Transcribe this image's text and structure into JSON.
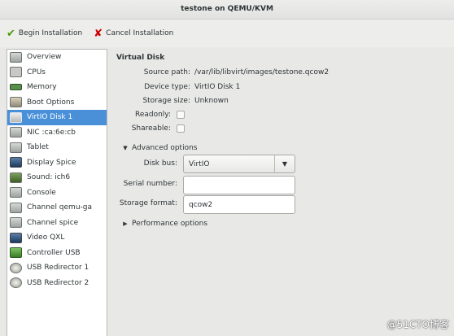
{
  "window": {
    "title": "testone on QEMU/KVM"
  },
  "toolbar": {
    "begin_label": "Begin Installation",
    "cancel_label": "Cancel Installation",
    "begin_icon": "check-icon",
    "cancel_icon": "cancel-x-icon"
  },
  "sidebar": {
    "selected_index": 5,
    "items": [
      {
        "label": "Overview",
        "icon": "overview-icon"
      },
      {
        "label": "CPUs",
        "icon": "cpu-icon"
      },
      {
        "label": "Memory",
        "icon": "memory-icon"
      },
      {
        "label": "Boot Options",
        "icon": "boot-options-icon"
      },
      {
        "label": "VirtIO Disk 1",
        "icon": "disk-icon"
      },
      {
        "label": "NIC :ca:6e:cb",
        "icon": "nic-icon"
      },
      {
        "label": "Tablet",
        "icon": "tablet-icon"
      },
      {
        "label": "Display Spice",
        "icon": "display-icon"
      },
      {
        "label": "Sound: ich6",
        "icon": "sound-icon"
      },
      {
        "label": "Console",
        "icon": "console-icon"
      },
      {
        "label": "Channel qemu-ga",
        "icon": "channel-icon"
      },
      {
        "label": "Channel spice",
        "icon": "channel-icon"
      },
      {
        "label": "Video QXL",
        "icon": "video-icon"
      },
      {
        "label": "Controller USB",
        "icon": "controller-icon"
      },
      {
        "label": "USB Redirector 1",
        "icon": "usb-redirector-icon"
      },
      {
        "label": "USB Redirector 2",
        "icon": "usb-redirector-icon"
      }
    ]
  },
  "details": {
    "title": "Virtual Disk",
    "source_path_label": "Source path:",
    "source_path_value": "/var/lib/libvirt/images/testone.qcow2",
    "device_type_label": "Device type:",
    "device_type_value": "VirtIO Disk 1",
    "storage_size_label": "Storage size:",
    "storage_size_value": "Unknown",
    "readonly_label": "Readonly:",
    "readonly_checked": false,
    "shareable_label": "Shareable:",
    "shareable_checked": false,
    "advanced_label": "Advanced options",
    "disk_bus_label": "Disk bus:",
    "disk_bus_value": "VirtIO",
    "serial_label": "Serial number:",
    "serial_value": "",
    "storage_format_label": "Storage format:",
    "storage_format_value": "qcow2",
    "performance_label": "Performance options"
  },
  "watermark": "@51CTO博客"
}
